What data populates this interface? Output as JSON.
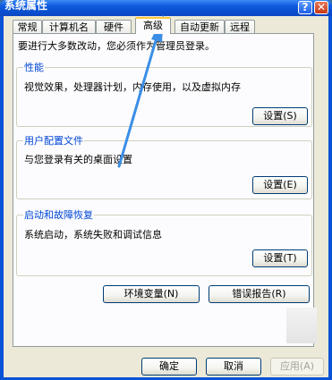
{
  "window": {
    "title": "系统属性"
  },
  "titlebar": {
    "help_label": "?",
    "close_label": "✕"
  },
  "tabs": [
    {
      "label": "常规"
    },
    {
      "label": "计算机名"
    },
    {
      "label": "硬件"
    },
    {
      "label": "高级",
      "active": true
    },
    {
      "label": "自动更新"
    },
    {
      "label": "远程"
    }
  ],
  "notice": "要进行大多数改动，您必须作为管理员登录。",
  "performance": {
    "title": "性能",
    "description": "视觉效果，处理器计划，内存使用，以及虚拟内存",
    "button": "设置(S)"
  },
  "user_profiles": {
    "title": "用户配置文件",
    "description": "与您登录有关的桌面设置",
    "button": "设置(E)"
  },
  "startup_recovery": {
    "title": "启动和故障恢复",
    "description": "系统启动，系统失败和调试信息",
    "button": "设置(T)"
  },
  "bottom_buttons": {
    "env_vars": "环境变量(N)",
    "error_report": "错误报告(R)"
  },
  "dialog_buttons": {
    "ok": "确定",
    "cancel": "取消",
    "apply": "应用(A)"
  },
  "colors": {
    "titlebar": "#0a52d6",
    "face": "#ece9d8",
    "tab_highlight": "#ffc83c",
    "group_title": "#0046d5",
    "annotation_arrow": "#3a8ee6"
  },
  "icons": {
    "annotation": "arrow-pointer-icon"
  }
}
